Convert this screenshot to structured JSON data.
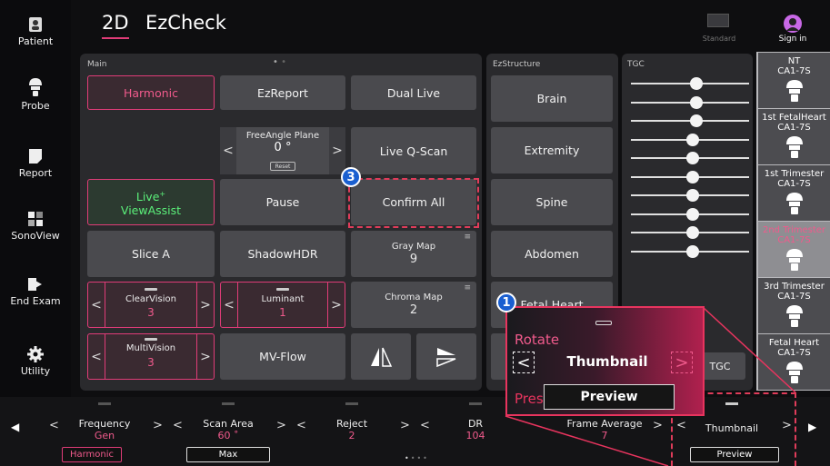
{
  "sidebar": {
    "items": [
      {
        "label": "Patient",
        "icon": "patient-icon"
      },
      {
        "label": "Probe",
        "icon": "probe-icon"
      },
      {
        "label": "Report",
        "icon": "report-icon"
      },
      {
        "label": "SonoView",
        "icon": "sonoview-icon"
      },
      {
        "label": "End Exam",
        "icon": "end-exam-icon"
      },
      {
        "label": "Utility",
        "icon": "gear-icon"
      }
    ]
  },
  "header": {
    "mode": "2D",
    "title": "EzCheck",
    "standard_label": "Standard",
    "sign_in_label": "Sign in"
  },
  "main": {
    "title": "Main",
    "buttons": {
      "harmonic": "Harmonic",
      "ezreport": "EzReport",
      "dual_live": "Dual Live",
      "live_qscan": "Live Q-Scan",
      "live": "Live",
      "viewassist": "ViewAssist",
      "pause": "Pause",
      "confirm_all": "Confirm All",
      "slice_a": "Slice A",
      "shadowhdr": "ShadowHDR",
      "mv_flow": "MV-Flow"
    },
    "freeangle": {
      "label": "FreeAngle Plane",
      "value": "0 °",
      "reset": "Reset"
    },
    "gray_map": {
      "label": "Gray Map",
      "value": "9"
    },
    "chroma_map": {
      "label": "Chroma Map",
      "value": "2"
    },
    "clearvision": {
      "label": "ClearVision",
      "value": "3"
    },
    "luminant": {
      "label": "Luminant",
      "value": "1"
    },
    "multivision": {
      "label": "MultiVision",
      "value": "3"
    }
  },
  "ezstructure": {
    "title": "EzStructure",
    "items": [
      "Brain",
      "Extremity",
      "Spine",
      "Abdomen",
      "Fetal Heart"
    ]
  },
  "tgc": {
    "title": "TGC",
    "button": "TGC",
    "levels": [
      0.55,
      0.55,
      0.55,
      0.52,
      0.52,
      0.52,
      0.52,
      0.52,
      0.52,
      0.52
    ]
  },
  "presets": [
    {
      "name": "NT",
      "probe": "CA1-7S",
      "selected": false
    },
    {
      "name": "1st FetalHeart",
      "probe": "CA1-7S",
      "selected": false
    },
    {
      "name": "1st Trimester",
      "probe": "CA1-7S",
      "selected": false
    },
    {
      "name": "2nd Trimester",
      "probe": "CA1-7S",
      "selected": true
    },
    {
      "name": "3rd Trimester",
      "probe": "CA1-7S",
      "selected": false
    },
    {
      "name": "Fetal Heart",
      "probe": "CA1-7S",
      "selected": false
    }
  ],
  "bottom": {
    "frequency": {
      "label": "Frequency",
      "value": "Gen",
      "button": "Harmonic"
    },
    "scan_area": {
      "label": "Scan Area",
      "value": "60 ˚",
      "button": "Max"
    },
    "reject": {
      "label": "Reject",
      "value": "2"
    },
    "dr": {
      "label": "DR",
      "value": "104"
    },
    "frame_average": {
      "label": "Frame Average",
      "value": "7"
    },
    "thumbnail": {
      "label": "Thumbnail",
      "button": "Preview"
    }
  },
  "callouts": {
    "badge1": "1",
    "badge3": "3",
    "zoom_rotate": "Rotate",
    "zoom_thumbnail": "Thumbnail",
    "zoom_press": "Press",
    "zoom_preview": "Preview"
  },
  "colors": {
    "accent": "#e03c78",
    "value_pink": "#f05a8c",
    "green": "#5bf07a",
    "badge_blue": "#1a5fd0",
    "callout_red": "#e8345e"
  }
}
